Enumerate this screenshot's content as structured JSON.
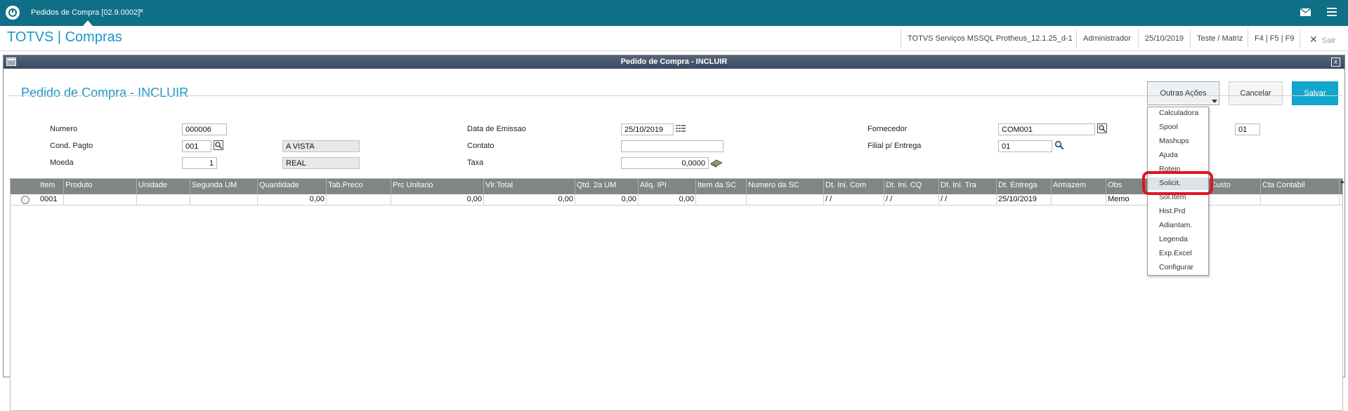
{
  "topbar": {
    "tab_label": "Pedidos de Compra [02.9.0002]",
    "tab_close": "×"
  },
  "appbar": {
    "title": "TOTVS | Compras",
    "environment": "TOTVS Serviços MSSQL Protheus_12.1.25_d-1",
    "user": "Administrador",
    "date": "25/10/2019",
    "company": "Teste / Matriz",
    "shortcuts": "F4 | F5 | F9",
    "exit_label": "Sair",
    "exit_icon": "✕"
  },
  "dialog": {
    "title": "Pedido de Compra - INCLUIR",
    "close": "x",
    "form_title": "Pedido de Compra - INCLUIR",
    "buttons": {
      "other_actions": "Outras Ações",
      "cancel": "Cancelar",
      "save": "Salvar"
    }
  },
  "form": {
    "numero": {
      "label": "Numero",
      "value": "000006"
    },
    "cond_pagto": {
      "label": "Cond. Pagto",
      "value": "001",
      "desc": "A VISTA"
    },
    "moeda": {
      "label": "Moeda",
      "value": "1",
      "desc": "REAL"
    },
    "data_emissao": {
      "label": "Data de Emissao",
      "value": "25/10/2019"
    },
    "contato": {
      "label": "Contato",
      "value": ""
    },
    "taxa": {
      "label": "Taxa",
      "value": "0,0000"
    },
    "fornecedor": {
      "label": "Fornecedor",
      "value": "COM001",
      "loja": "01"
    },
    "filial_entrega": {
      "label": "Filial p/ Entrega",
      "value": "01"
    }
  },
  "grid": {
    "headers": [
      "Item",
      "Produto",
      "Unidade",
      "Segunda UM",
      "Quantidade",
      "Tab.Preco",
      "Prc Unitario",
      "Vlr.Total",
      "Qtd. 2a UM",
      "Aliq. IPI",
      "Item da SC",
      "Numero da SC",
      "Dt. Ini. Com",
      "Dt. Ini. CQ",
      "Dt. Ini. Tra",
      "Dt. Entrega",
      "Armazem",
      "Obs",
      "Centro Custo",
      "Cta Contabil"
    ],
    "row": {
      "item": "0001",
      "produto": "",
      "unidade": "",
      "segunda_um": "",
      "quantidade": "0,00",
      "tab_preco": "",
      "prc_unitario": "0,00",
      "vlr_total": "0,00",
      "qtd_2a_um": "0,00",
      "aliq_ipi": "0,00",
      "item_sc": "",
      "numero_sc": "",
      "dt_ini_com": " /  /",
      "dt_ini_cq": " /  /",
      "dt_ini_tra": " /  /",
      "dt_entrega": "25/10/2019",
      "armazem": "",
      "obs": "Memo",
      "centro_custo": "",
      "cta_contabil": ""
    }
  },
  "menu": {
    "items": [
      "Calculadora",
      "Spool",
      "Mashups",
      "Ajuda",
      "Rotein",
      "Solicit.",
      "Sol.Item",
      "Hist.Prd",
      "Adiantam.",
      "Legenda",
      "Exp.Excel",
      "Configurar"
    ],
    "selected": "Solicit."
  },
  "colors": {
    "topbar": "#0e6f86",
    "accent": "#1b95c8",
    "save_button": "#12a7cc",
    "dialog_titlebar": "#3b4a5f",
    "grid_header": "#808585",
    "highlight": "#e0141f"
  },
  "icons": [
    "totvs-logo-icon",
    "mail-icon",
    "menu-icon",
    "lookup-icon",
    "calendar-icon",
    "search-icon",
    "calculator-icon",
    "close-icon"
  ]
}
